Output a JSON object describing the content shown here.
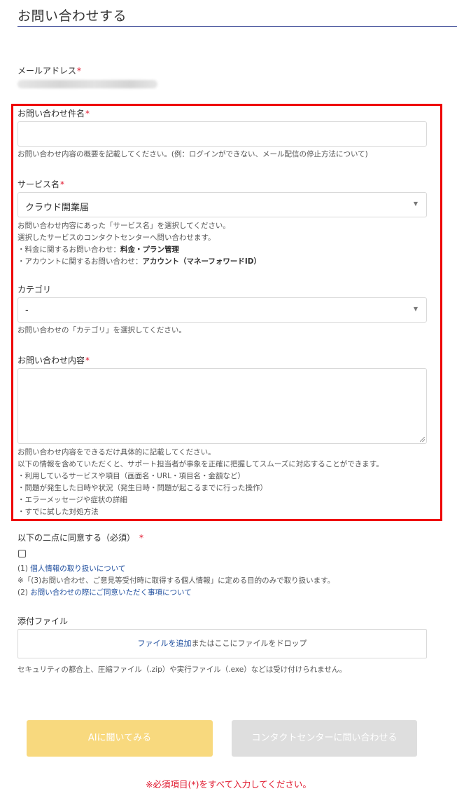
{
  "page": {
    "title": "お問い合わせする"
  },
  "required_mark": "*",
  "email": {
    "label": "メールアドレス"
  },
  "subject": {
    "label": "お問い合わせ件名",
    "value": "",
    "help": "お問い合わせ内容の概要を記載してください。(例：ログインができない、メール配信の停止方法について)"
  },
  "service": {
    "label": "サービス名",
    "selected": "クラウド開業届",
    "arrow": "▼",
    "help_lines": [
      "お問い合わせ内容にあった「サービス名」を選択してください。",
      "選択したサービスのコンタクトセンターへ問い合わせます。"
    ],
    "help_billing_prefix": "・料金に関するお問い合わせ：",
    "help_billing_value": "料金・プラン管理",
    "help_account_prefix": "・アカウントに関するお問い合わせ：",
    "help_account_value": "アカウント（マネーフォワードID）"
  },
  "category": {
    "label": "カテゴリ",
    "selected": "-",
    "arrow": "▼",
    "help": "お問い合わせの「カテゴリ」を選択してください。"
  },
  "content": {
    "label": "お問い合わせ内容",
    "value": "",
    "help_lines": [
      "お問い合わせ内容をできるだけ具体的に記載してください。",
      "以下の情報を含めていただくと、サポート担当者が事象を正確に把握してスムーズに対応することができます。",
      "・利用しているサービスや項目（画面名・URL・項目名・金額など）",
      "・問題が発生した日時や状況（発生日時・問題が起こるまでに行った操作）",
      "・エラーメッセージや症状の詳細",
      "・すでに試した対処方法"
    ]
  },
  "agreement": {
    "label": "以下の二点に同意する（必須）",
    "item1_prefix": "(1) ",
    "item1_link": "個人情報の取り扱いについて",
    "note": "※「(3)お問い合わせ、ご意見等受付時に取得する個人情報」に定める目的のみで取り扱います。",
    "item2_prefix": "(2) ",
    "item2_link": "お問い合わせの際にご同意いただく事項について"
  },
  "attachment": {
    "label": "添付ファイル",
    "add_link": "ファイルを追加",
    "drop_text": "またはここにファイルをドロップ",
    "note": "セキュリティの都合上、圧縮ファイル（.zip）や実行ファイル（.exe）などは受け付けられません。"
  },
  "buttons": {
    "ai_label": "AIに聞いてみる",
    "contact_label": "コンタクトセンターに問い合わせる"
  },
  "error_message": "※必須項目(*)をすべて入力してください。",
  "colors": {
    "required": "#e0152b",
    "highlight_border": "#ee0000",
    "link": "#1f4e9e",
    "ai_button": "#f8d97e",
    "contact_button": "#dedede",
    "title_rule": "#2f3f8f"
  }
}
